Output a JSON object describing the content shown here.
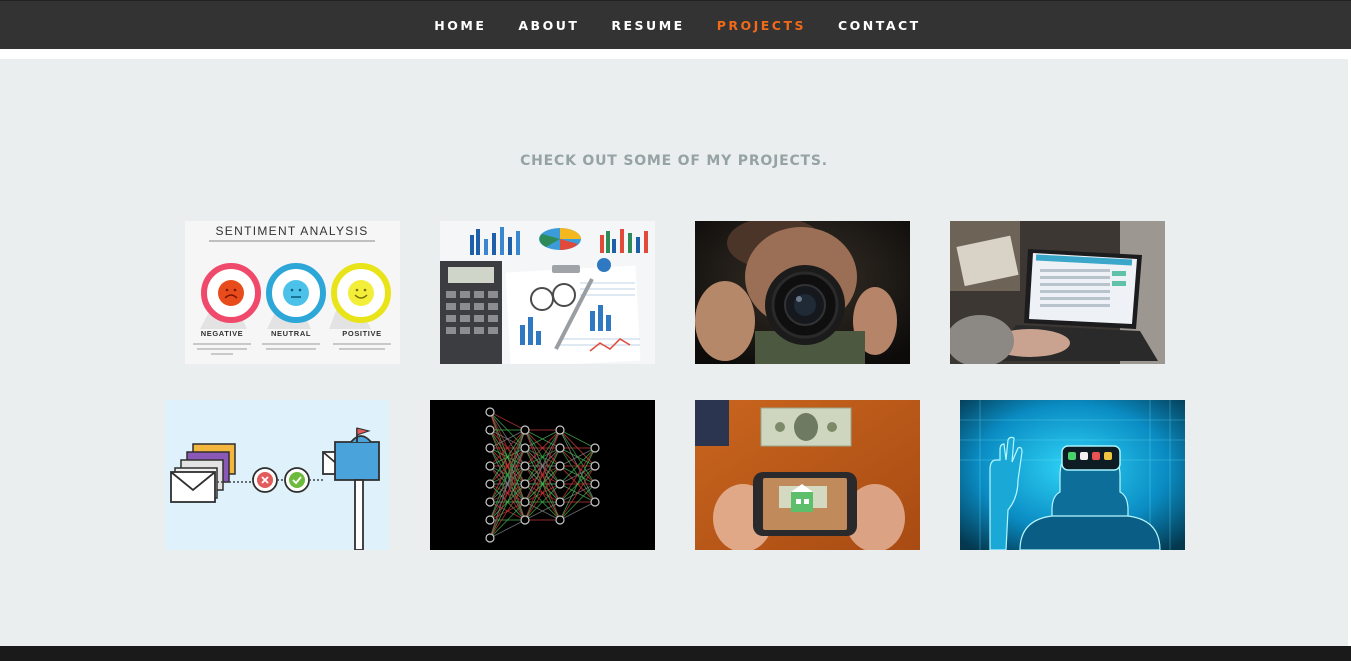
{
  "nav": {
    "items": [
      "HOME",
      "ABOUT",
      "RESUME",
      "PROJECTS",
      "CONTACT"
    ],
    "active": "PROJECTS",
    "active_color": "#f06a1a",
    "bg_color": "#333333"
  },
  "portfolio": {
    "title": "CHECK OUT SOME OF MY PROJECTS.",
    "bg_color": "#ebeeee",
    "projects": [
      {
        "icon": "sentiment-analysis-thumbnail",
        "heading": "SENTIMENT ANALYSIS",
        "labels": [
          "NEGATIVE",
          "NEUTRAL",
          "POSITIVE"
        ]
      },
      {
        "icon": "data-analysis-charts-thumbnail"
      },
      {
        "icon": "photographer-camera-thumbnail"
      },
      {
        "icon": "laptop-dashboard-thumbnail"
      },
      {
        "icon": "email-spam-filter-thumbnail"
      },
      {
        "icon": "neural-network-thumbnail"
      },
      {
        "icon": "augmented-reality-phone-thumbnail"
      },
      {
        "icon": "virtual-reality-headset-thumbnail"
      }
    ]
  }
}
